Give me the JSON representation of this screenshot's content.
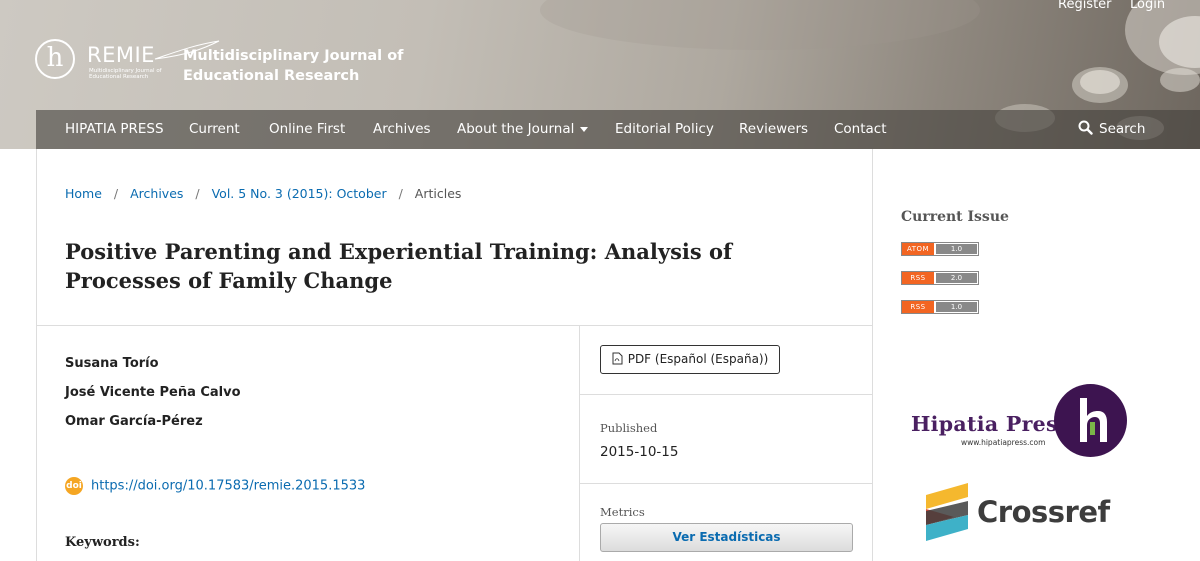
{
  "header": {
    "user_links": {
      "register": "Register",
      "login": "Login"
    },
    "brand": {
      "logo_letter": "h",
      "acronym": "REMIE",
      "acronym_subtitle": "Multidisciplinary Journal of Educational Research",
      "title": "Multidisciplinary Journal of Educational Research"
    },
    "nav": {
      "items": [
        {
          "label": "HIPATIA PRESS"
        },
        {
          "label": "Current"
        },
        {
          "label": "Online First"
        },
        {
          "label": "Archives"
        },
        {
          "label": "About the Journal",
          "dropdown": true
        },
        {
          "label": "Editorial Policy"
        },
        {
          "label": "Reviewers"
        },
        {
          "label": "Contact"
        }
      ],
      "search_label": "Search"
    }
  },
  "breadcrumb": {
    "home": "Home",
    "archives": "Archives",
    "issue": "Vol. 5 No. 3 (2015): October",
    "current": "Articles",
    "separator": "/"
  },
  "article": {
    "title": "Positive Parenting and Experiential Training: Analysis of Processes of Family Change",
    "authors": [
      "Susana Torío",
      "José Vicente Peña Calvo",
      "Omar García-Pérez"
    ],
    "doi_badge": "doi",
    "doi_url": "https://doi.org/10.17583/remie.2015.1533",
    "keywords_label": "Keywords:"
  },
  "galley": {
    "pdf_label": "PDF (Español (España))",
    "published_label": "Published",
    "published_date": "2015-10-15",
    "metrics_label": "Metrics",
    "stats_button": "Ver Estadísticas"
  },
  "sidebar": {
    "current_issue_title": "Current Issue",
    "feeds": [
      {
        "type": "ATOM",
        "version": "1.0"
      },
      {
        "type": "RSS",
        "version": "2.0"
      },
      {
        "type": "RSS",
        "version": "1.0"
      }
    ],
    "hipatia": {
      "name": "Hipatia Press",
      "url": "www.hipatiapress.com",
      "logo_letter": "h"
    },
    "crossref": {
      "name": "Crossref"
    }
  },
  "colors": {
    "link": "#0a6bb0",
    "feed_orange": "#f26522",
    "hipatia_purple": "#3d1450",
    "crossref_red": "#e24d3d",
    "crossref_yellow": "#f5b82e",
    "crossref_teal": "#3eb1c8"
  }
}
